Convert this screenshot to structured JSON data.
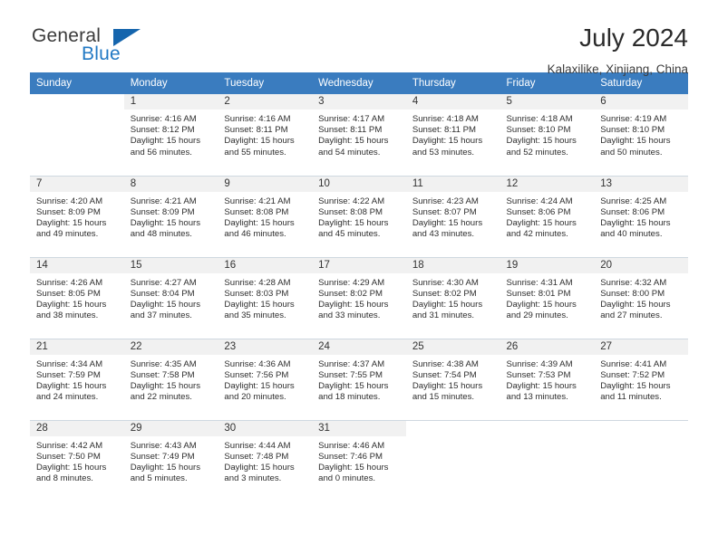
{
  "brand": {
    "name_top": "General",
    "name_bottom": "Blue",
    "accent_color": "#2279c4",
    "triangle_color": "#1565ad"
  },
  "header": {
    "title": "July 2024",
    "subtitle": "Kalaxilike, Xinjiang, China"
  },
  "calendar": {
    "header_color": "#3a7cbf",
    "daynum_bg": "#f1f1f1",
    "weekday_headers": [
      "Sunday",
      "Monday",
      "Tuesday",
      "Wednesday",
      "Thursday",
      "Friday",
      "Saturday"
    ],
    "weeks": [
      [
        {
          "day": "",
          "sunrise": "",
          "sunset": "",
          "daylight": ""
        },
        {
          "day": "1",
          "sunrise": "Sunrise: 4:16 AM",
          "sunset": "Sunset: 8:12 PM",
          "daylight": "Daylight: 15 hours and 56 minutes."
        },
        {
          "day": "2",
          "sunrise": "Sunrise: 4:16 AM",
          "sunset": "Sunset: 8:11 PM",
          "daylight": "Daylight: 15 hours and 55 minutes."
        },
        {
          "day": "3",
          "sunrise": "Sunrise: 4:17 AM",
          "sunset": "Sunset: 8:11 PM",
          "daylight": "Daylight: 15 hours and 54 minutes."
        },
        {
          "day": "4",
          "sunrise": "Sunrise: 4:18 AM",
          "sunset": "Sunset: 8:11 PM",
          "daylight": "Daylight: 15 hours and 53 minutes."
        },
        {
          "day": "5",
          "sunrise": "Sunrise: 4:18 AM",
          "sunset": "Sunset: 8:10 PM",
          "daylight": "Daylight: 15 hours and 52 minutes."
        },
        {
          "day": "6",
          "sunrise": "Sunrise: 4:19 AM",
          "sunset": "Sunset: 8:10 PM",
          "daylight": "Daylight: 15 hours and 50 minutes."
        }
      ],
      [
        {
          "day": "7",
          "sunrise": "Sunrise: 4:20 AM",
          "sunset": "Sunset: 8:09 PM",
          "daylight": "Daylight: 15 hours and 49 minutes."
        },
        {
          "day": "8",
          "sunrise": "Sunrise: 4:21 AM",
          "sunset": "Sunset: 8:09 PM",
          "daylight": "Daylight: 15 hours and 48 minutes."
        },
        {
          "day": "9",
          "sunrise": "Sunrise: 4:21 AM",
          "sunset": "Sunset: 8:08 PM",
          "daylight": "Daylight: 15 hours and 46 minutes."
        },
        {
          "day": "10",
          "sunrise": "Sunrise: 4:22 AM",
          "sunset": "Sunset: 8:08 PM",
          "daylight": "Daylight: 15 hours and 45 minutes."
        },
        {
          "day": "11",
          "sunrise": "Sunrise: 4:23 AM",
          "sunset": "Sunset: 8:07 PM",
          "daylight": "Daylight: 15 hours and 43 minutes."
        },
        {
          "day": "12",
          "sunrise": "Sunrise: 4:24 AM",
          "sunset": "Sunset: 8:06 PM",
          "daylight": "Daylight: 15 hours and 42 minutes."
        },
        {
          "day": "13",
          "sunrise": "Sunrise: 4:25 AM",
          "sunset": "Sunset: 8:06 PM",
          "daylight": "Daylight: 15 hours and 40 minutes."
        }
      ],
      [
        {
          "day": "14",
          "sunrise": "Sunrise: 4:26 AM",
          "sunset": "Sunset: 8:05 PM",
          "daylight": "Daylight: 15 hours and 38 minutes."
        },
        {
          "day": "15",
          "sunrise": "Sunrise: 4:27 AM",
          "sunset": "Sunset: 8:04 PM",
          "daylight": "Daylight: 15 hours and 37 minutes."
        },
        {
          "day": "16",
          "sunrise": "Sunrise: 4:28 AM",
          "sunset": "Sunset: 8:03 PM",
          "daylight": "Daylight: 15 hours and 35 minutes."
        },
        {
          "day": "17",
          "sunrise": "Sunrise: 4:29 AM",
          "sunset": "Sunset: 8:02 PM",
          "daylight": "Daylight: 15 hours and 33 minutes."
        },
        {
          "day": "18",
          "sunrise": "Sunrise: 4:30 AM",
          "sunset": "Sunset: 8:02 PM",
          "daylight": "Daylight: 15 hours and 31 minutes."
        },
        {
          "day": "19",
          "sunrise": "Sunrise: 4:31 AM",
          "sunset": "Sunset: 8:01 PM",
          "daylight": "Daylight: 15 hours and 29 minutes."
        },
        {
          "day": "20",
          "sunrise": "Sunrise: 4:32 AM",
          "sunset": "Sunset: 8:00 PM",
          "daylight": "Daylight: 15 hours and 27 minutes."
        }
      ],
      [
        {
          "day": "21",
          "sunrise": "Sunrise: 4:34 AM",
          "sunset": "Sunset: 7:59 PM",
          "daylight": "Daylight: 15 hours and 24 minutes."
        },
        {
          "day": "22",
          "sunrise": "Sunrise: 4:35 AM",
          "sunset": "Sunset: 7:58 PM",
          "daylight": "Daylight: 15 hours and 22 minutes."
        },
        {
          "day": "23",
          "sunrise": "Sunrise: 4:36 AM",
          "sunset": "Sunset: 7:56 PM",
          "daylight": "Daylight: 15 hours and 20 minutes."
        },
        {
          "day": "24",
          "sunrise": "Sunrise: 4:37 AM",
          "sunset": "Sunset: 7:55 PM",
          "daylight": "Daylight: 15 hours and 18 minutes."
        },
        {
          "day": "25",
          "sunrise": "Sunrise: 4:38 AM",
          "sunset": "Sunset: 7:54 PM",
          "daylight": "Daylight: 15 hours and 15 minutes."
        },
        {
          "day": "26",
          "sunrise": "Sunrise: 4:39 AM",
          "sunset": "Sunset: 7:53 PM",
          "daylight": "Daylight: 15 hours and 13 minutes."
        },
        {
          "day": "27",
          "sunrise": "Sunrise: 4:41 AM",
          "sunset": "Sunset: 7:52 PM",
          "daylight": "Daylight: 15 hours and 11 minutes."
        }
      ],
      [
        {
          "day": "28",
          "sunrise": "Sunrise: 4:42 AM",
          "sunset": "Sunset: 7:50 PM",
          "daylight": "Daylight: 15 hours and 8 minutes."
        },
        {
          "day": "29",
          "sunrise": "Sunrise: 4:43 AM",
          "sunset": "Sunset: 7:49 PM",
          "daylight": "Daylight: 15 hours and 5 minutes."
        },
        {
          "day": "30",
          "sunrise": "Sunrise: 4:44 AM",
          "sunset": "Sunset: 7:48 PM",
          "daylight": "Daylight: 15 hours and 3 minutes."
        },
        {
          "day": "31",
          "sunrise": "Sunrise: 4:46 AM",
          "sunset": "Sunset: 7:46 PM",
          "daylight": "Daylight: 15 hours and 0 minutes."
        },
        {
          "day": "",
          "sunrise": "",
          "sunset": "",
          "daylight": ""
        },
        {
          "day": "",
          "sunrise": "",
          "sunset": "",
          "daylight": ""
        },
        {
          "day": "",
          "sunrise": "",
          "sunset": "",
          "daylight": ""
        }
      ]
    ]
  }
}
